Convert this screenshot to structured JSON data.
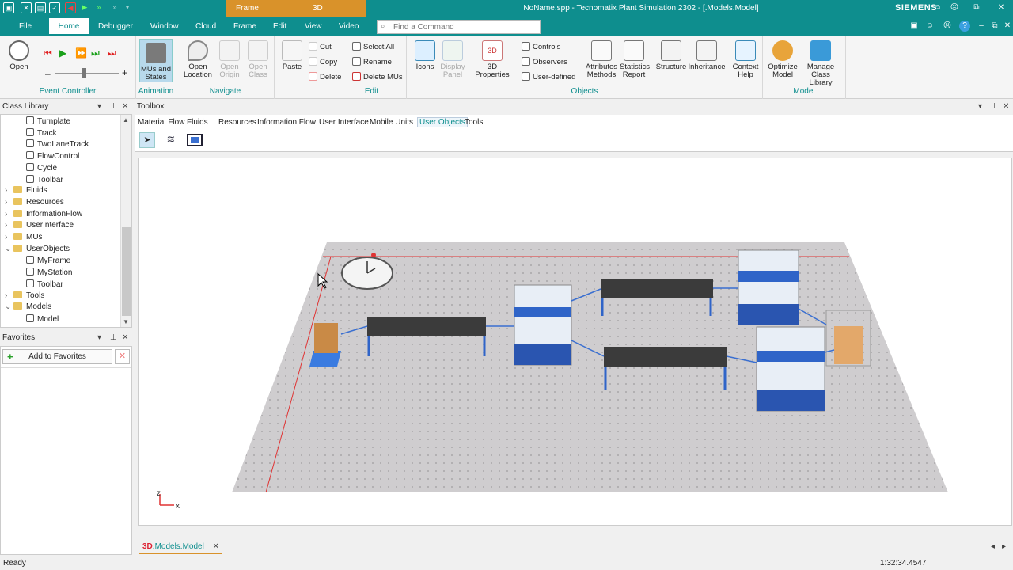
{
  "window": {
    "title": "NoName.spp - Tecnomatix Plant Simulation 2302 - [.Models.Model]",
    "brand": "SIEMENS",
    "context_tabs_group": [
      "Frame",
      "3D"
    ]
  },
  "tabs": [
    "File",
    "Home",
    "Debugger",
    "Window",
    "Cloud",
    "Frame",
    "Edit",
    "View",
    "Video"
  ],
  "search": {
    "placeholder": "Find a Command"
  },
  "ribbon": {
    "event_controller": {
      "label": "Event Controller",
      "open": "Open"
    },
    "animation": {
      "label": "Animation",
      "mus_states": "MUs and States"
    },
    "navigate": {
      "label": "Navigate",
      "open_location": "Open Location",
      "open_origin": "Open Origin",
      "open_class": "Open Class"
    },
    "edit": {
      "label": "Edit",
      "paste": "Paste",
      "cut": "Cut",
      "copy": "Copy",
      "delete": "Delete",
      "select_all": "Select All",
      "rename": "Rename",
      "delete_mus": "Delete MUs"
    },
    "objects": {
      "label": "Objects",
      "icons": "Icons",
      "display_panel": "Display Panel",
      "properties_3d": "3D Properties",
      "controls": "Controls",
      "observers": "Observers",
      "user_defined": "User-defined",
      "attributes_methods": "Attributes Methods",
      "statistics_report": "Statistics Report",
      "structure": "Structure",
      "inheritance": "Inheritance",
      "context_help": "Context Help"
    },
    "model": {
      "label": "Model",
      "optimize_model": "Optimize Model",
      "manage_class_library": "Manage Class Library"
    }
  },
  "class_library": {
    "title": "Class Library",
    "items": [
      {
        "label": "Turnplate",
        "indent": 2,
        "kind": "leaf"
      },
      {
        "label": "Track",
        "indent": 2,
        "kind": "leaf"
      },
      {
        "label": "TwoLaneTrack",
        "indent": 2,
        "kind": "leaf"
      },
      {
        "label": "FlowControl",
        "indent": 2,
        "kind": "leaf"
      },
      {
        "label": "Cycle",
        "indent": 2,
        "kind": "leaf"
      },
      {
        "label": "Toolbar",
        "indent": 2,
        "kind": "leaf"
      },
      {
        "label": "Fluids",
        "indent": 1,
        "kind": "folder",
        "expanded": false
      },
      {
        "label": "Resources",
        "indent": 1,
        "kind": "folder",
        "expanded": false
      },
      {
        "label": "InformationFlow",
        "indent": 1,
        "kind": "folder",
        "expanded": false
      },
      {
        "label": "UserInterface",
        "indent": 1,
        "kind": "folder",
        "expanded": false
      },
      {
        "label": "MUs",
        "indent": 1,
        "kind": "folder",
        "expanded": false
      },
      {
        "label": "UserObjects",
        "indent": 1,
        "kind": "folder",
        "expanded": true
      },
      {
        "label": "MyFrame",
        "indent": 2,
        "kind": "leaf"
      },
      {
        "label": "MyStation",
        "indent": 2,
        "kind": "leaf"
      },
      {
        "label": "Toolbar",
        "indent": 2,
        "kind": "leaf"
      },
      {
        "label": "Tools",
        "indent": 1,
        "kind": "folder",
        "expanded": false
      },
      {
        "label": "Models",
        "indent": 1,
        "kind": "folder",
        "expanded": true
      },
      {
        "label": "Model",
        "indent": 2,
        "kind": "leaf"
      }
    ]
  },
  "favorites": {
    "title": "Favorites",
    "add_label": "Add to Favorites"
  },
  "toolbox": {
    "title": "Toolbox",
    "tabs": [
      "Material Flow",
      "Fluids",
      "Resources",
      "Information Flow",
      "User Interface",
      "Mobile Units",
      "User Objects",
      "Tools"
    ],
    "active_tab": "User Objects"
  },
  "viewport": {
    "axis_z": "z",
    "axis_x": "x"
  },
  "document_tab": {
    "prefix": "3D",
    "label": ".Models.Model"
  },
  "status": {
    "left": "Ready",
    "time": "1:32:34.4547"
  },
  "colors": {
    "accent": "#0e8e8e",
    "context": "#d9922a",
    "floor": "#cfcdcf",
    "table": "#3b3b3b",
    "machine": "#2f64c8"
  }
}
